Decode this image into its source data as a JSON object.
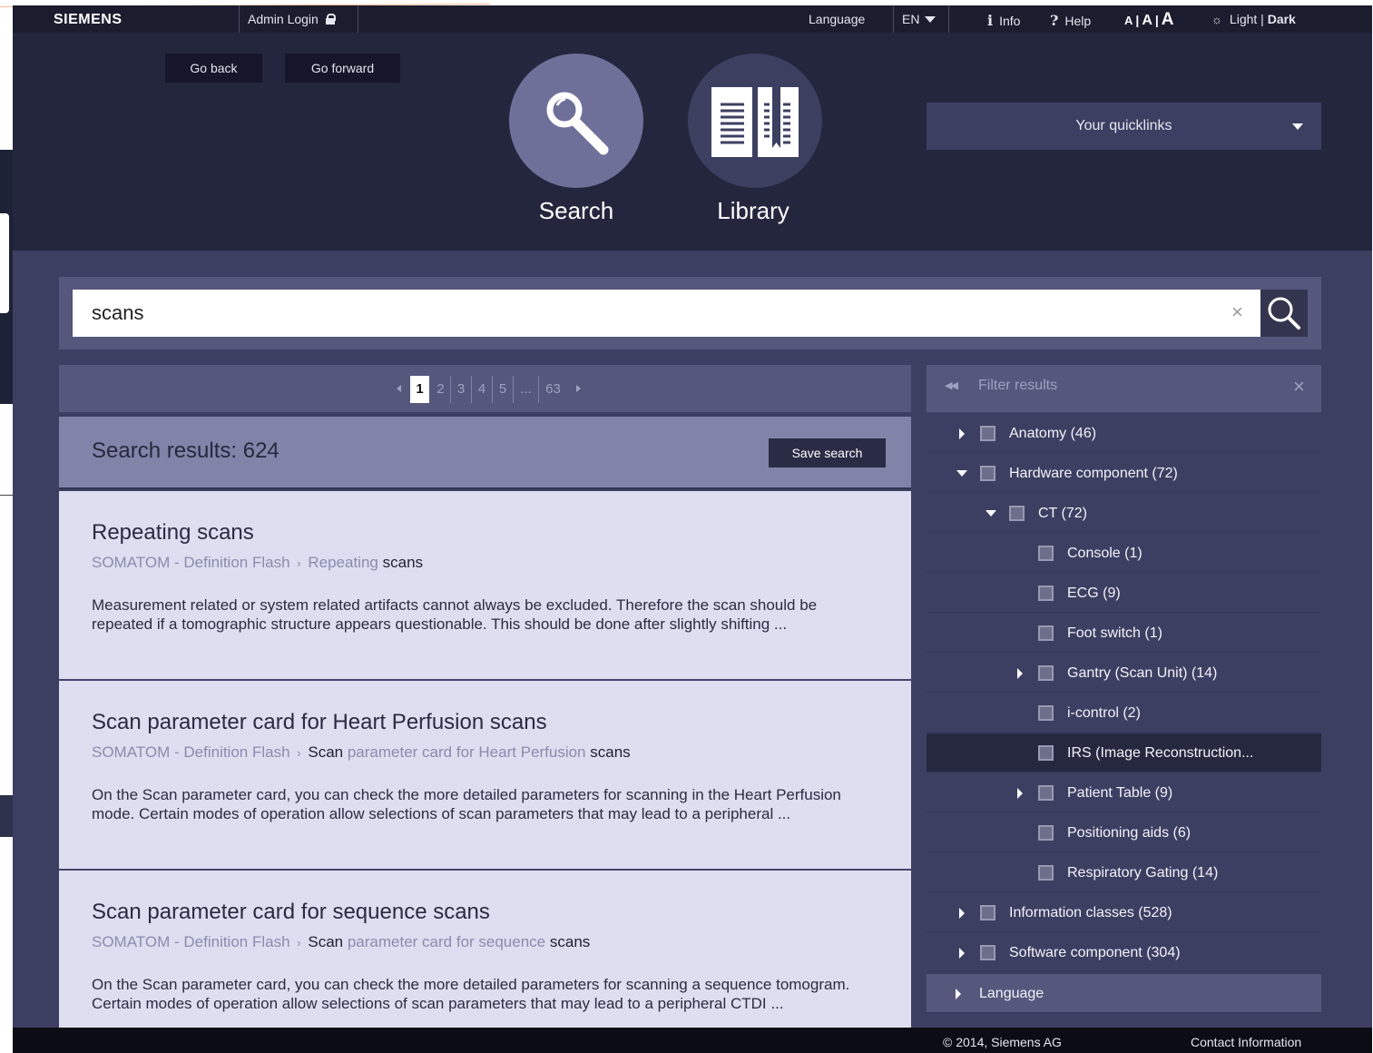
{
  "topbar": {
    "brand": "SIEMENS",
    "admin_login": "Admin Login",
    "language_label": "Language",
    "language_value": "EN",
    "info": "Info",
    "help": "Help",
    "font_small": "A",
    "font_medium": "A",
    "font_large": "A",
    "font_sep": "|",
    "theme_light": "Light",
    "theme_sep": " | ",
    "theme_dark": "Dark"
  },
  "header": {
    "go_back": "Go back",
    "go_forward": "Go forward",
    "search_label": "Search",
    "library_label": "Library",
    "quicklinks": "Your quicklinks"
  },
  "search": {
    "value": "scans",
    "clear": "×"
  },
  "pager": {
    "pages": [
      "1",
      "2",
      "3",
      "4",
      "5",
      "...",
      "63"
    ],
    "current": "1"
  },
  "results": {
    "count_label": "Search results: 624",
    "save_search": "Save search",
    "items": [
      {
        "title": "Repeating scans",
        "crumb_product": "SOMATOM - Definition Flash",
        "crumb_sep": "›",
        "crumb_parts": [
          {
            "text": "Repeating",
            "dark": false
          },
          {
            "text": "scans",
            "dark": true
          }
        ],
        "snippet": "Measurement related or system related artifacts cannot always be excluded. Therefore the scan should be repeated if a tomographic structure appears questionable. This should be done after slightly shifting ..."
      },
      {
        "title": "Scan parameter card for Heart Perfusion scans",
        "crumb_product": "SOMATOM - Definition Flash",
        "crumb_sep": "›",
        "crumb_parts": [
          {
            "text": "Scan",
            "dark": true
          },
          {
            "text": "parameter card for Heart Perfusion",
            "dark": false
          },
          {
            "text": "scans",
            "dark": true
          }
        ],
        "snippet": "On the Scan parameter card, you can check the more detailed parameters for scanning in the Heart Perfusion mode. Certain modes of operation allow selections of scan parameters that may lead to a peripheral ..."
      },
      {
        "title": "Scan parameter card for sequence scans",
        "crumb_product": "SOMATOM - Definition Flash",
        "crumb_sep": "›",
        "crumb_parts": [
          {
            "text": "Scan",
            "dark": true
          },
          {
            "text": "parameter card for sequence",
            "dark": false
          },
          {
            "text": "scans",
            "dark": true
          }
        ],
        "snippet": "On the Scan parameter card, you can check the more detailed parameters for scanning a sequence tomogram. Certain modes of operation allow selections of scan parameters that may lead to a peripheral CTDI ..."
      }
    ]
  },
  "filter": {
    "title": "Filter results",
    "collapse": "◀◀",
    "close": "×",
    "items": [
      {
        "label": "Anatomy (46)",
        "level": 0,
        "arrow": "right"
      },
      {
        "label": "Hardware component (72)",
        "level": 0,
        "arrow": "down"
      },
      {
        "label": "CT (72)",
        "level": 1,
        "arrow": "down"
      },
      {
        "label": "Console (1)",
        "level": 2,
        "arrow": "none"
      },
      {
        "label": "ECG (9)",
        "level": 2,
        "arrow": "none"
      },
      {
        "label": "Foot switch (1)",
        "level": 2,
        "arrow": "none"
      },
      {
        "label": "Gantry (Scan Unit) (14)",
        "level": 2,
        "arrow": "right"
      },
      {
        "label": "i-control (2)",
        "level": 2,
        "arrow": "none"
      },
      {
        "label": "IRS (Image Reconstruction...",
        "level": 2,
        "arrow": "none",
        "highlight": true
      },
      {
        "label": "Patient Table (9)",
        "level": 2,
        "arrow": "right"
      },
      {
        "label": "Positioning aids (6)",
        "level": 2,
        "arrow": "none"
      },
      {
        "label": "Respiratory Gating (14)",
        "level": 2,
        "arrow": "none"
      },
      {
        "label": "Information classes (528)",
        "level": 0,
        "arrow": "right"
      },
      {
        "label": "Software component (304)",
        "level": 0,
        "arrow": "right"
      }
    ],
    "language_section": "Language"
  },
  "footer": {
    "copyright": "© 2014, Siemens AG",
    "contact": "Contact Information"
  },
  "colors": {
    "topbar": "#1b1c2e",
    "header": "#24263e",
    "app_bg": "#3d3f62",
    "panel": "#55577c",
    "result_bg": "#dddeef",
    "accent_circle": "#6e7099"
  }
}
